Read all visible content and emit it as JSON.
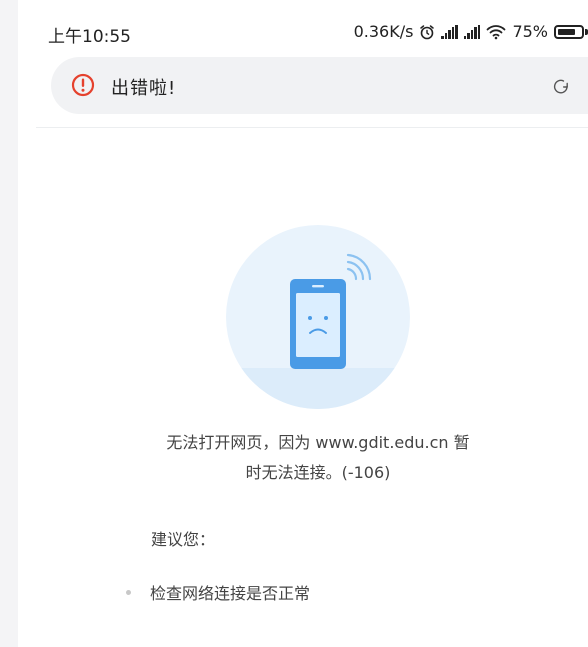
{
  "status": {
    "time": "上午10:55",
    "speed": "0.36K/s",
    "battery": "75%",
    "battery_level": 0.75
  },
  "urlbar": {
    "title": "出错啦!"
  },
  "error": {
    "message_line1": "无法打开网页，因为 www.gdit.edu.cn 暂",
    "message_line2": "时无法连接。(-106)",
    "suggest_heading": "建议您：",
    "suggestions": [
      "检查网络连接是否正常"
    ]
  },
  "colors": {
    "error_red": "#e5412d",
    "illus_circle": "#e9f3fc",
    "phone_blue": "#4a9be6"
  }
}
